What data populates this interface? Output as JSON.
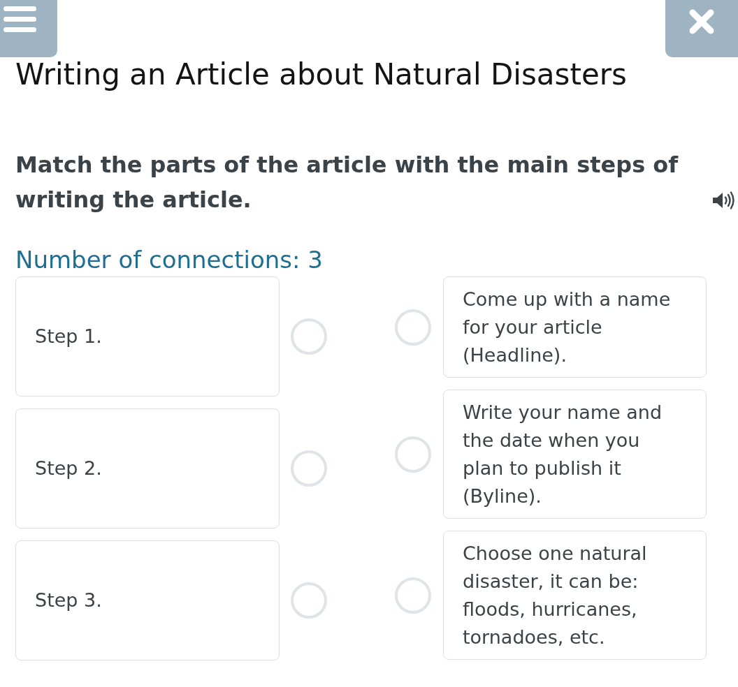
{
  "title": "Writing an Article about Natural Disasters",
  "instruction": "Match the parts of the article with the main steps of writing the article.",
  "connections_label": "Number of connections: 3",
  "left_items": [
    {
      "label": "Step 1."
    },
    {
      "label": "Step 2."
    },
    {
      "label": "Step 3."
    }
  ],
  "right_items": [
    {
      "text": "Come up with a name for your article (Headline)."
    },
    {
      "text": "Write your name and the date when you plan to publish it (Byline)."
    },
    {
      "text": "Choose one natural disaster, it can be: floods, hurricanes, tornadoes, etc."
    }
  ]
}
